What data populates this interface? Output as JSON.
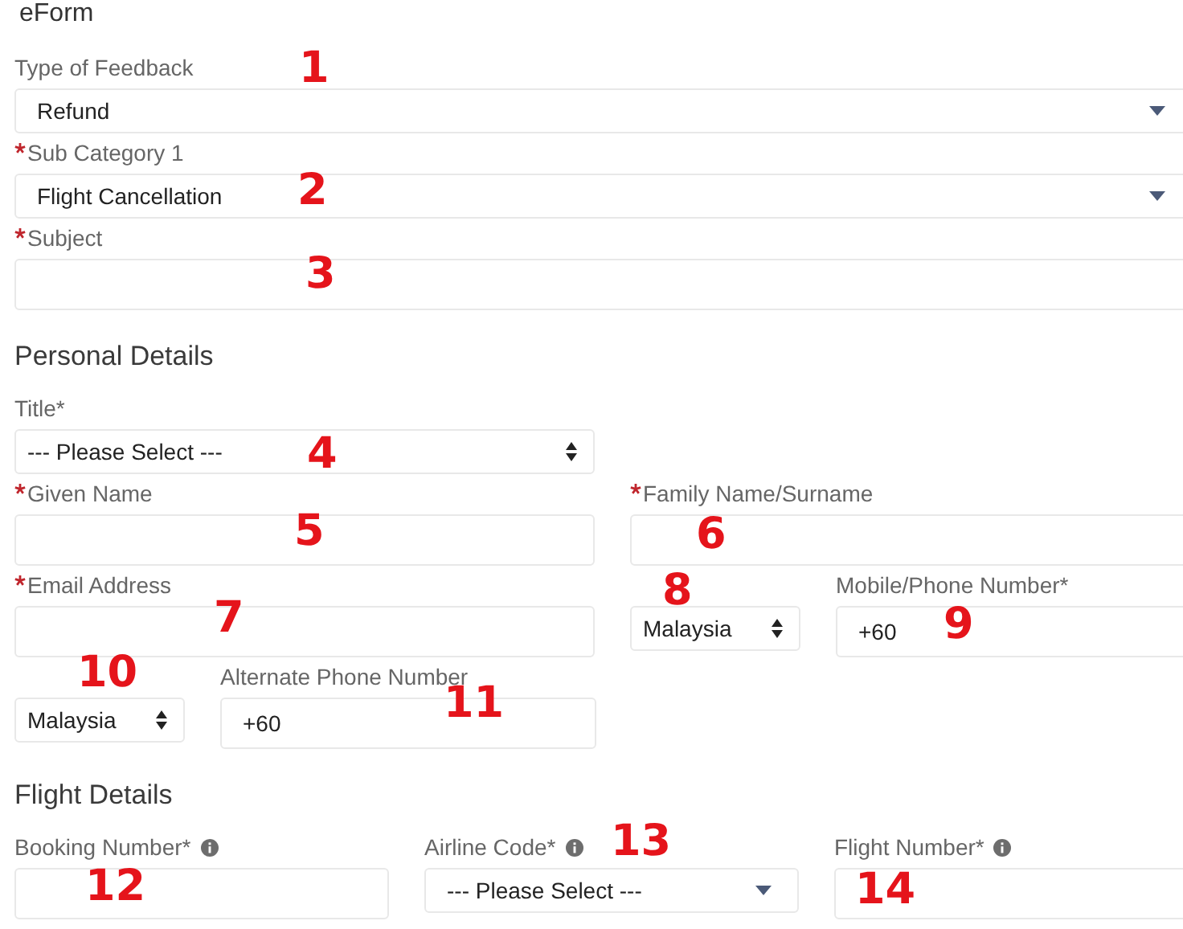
{
  "title": "eForm",
  "sections": [
    {
      "rows": [
        [
          {
            "label": "Type of Feedback",
            "required": false,
            "kind": "dropdown",
            "value": "Refund"
          }
        ],
        [
          {
            "label": "Sub Category 1",
            "required": true,
            "kind": "dropdown",
            "value": "Flight Cancellation"
          }
        ],
        [
          {
            "label": "Subject",
            "required": true,
            "kind": "text"
          }
        ]
      ]
    },
    {
      "heading": "Personal Details",
      "rows": [
        [
          {
            "label": "Title*",
            "required": false,
            "kind": "select",
            "value": "--- Please Select ---"
          }
        ],
        [
          {
            "label": "Given Name",
            "required": true,
            "kind": "text"
          },
          {
            "label": "Family Name/Surname",
            "required": true,
            "kind": "text"
          }
        ],
        [
          {
            "label": "Email Address",
            "required": true,
            "kind": "text"
          },
          {
            "kind": "select",
            "value": "Malaysia"
          },
          {
            "label": "Mobile/Phone Number*",
            "required": false,
            "kind": "text",
            "value": "+60"
          }
        ],
        [
          {
            "kind": "select",
            "value": "Malaysia"
          },
          {
            "label": "Alternate Phone Number",
            "required": false,
            "kind": "text",
            "value": "+60"
          }
        ]
      ]
    },
    {
      "heading": "Flight Details",
      "rows": [
        [
          {
            "label": "Booking Number*",
            "required": false,
            "info": true,
            "kind": "text"
          },
          {
            "label": "Airline Code*",
            "required": false,
            "info": true,
            "kind": "dropdown",
            "value": "--- Please Select ---"
          },
          {
            "label": "Flight Number*",
            "required": false,
            "info": true,
            "kind": "text"
          }
        ]
      ]
    }
  ],
  "annotations": [
    "1",
    "2",
    "3",
    "4",
    "5",
    "6",
    "7",
    "8",
    "9",
    "10",
    "11",
    "12",
    "13",
    "14"
  ]
}
